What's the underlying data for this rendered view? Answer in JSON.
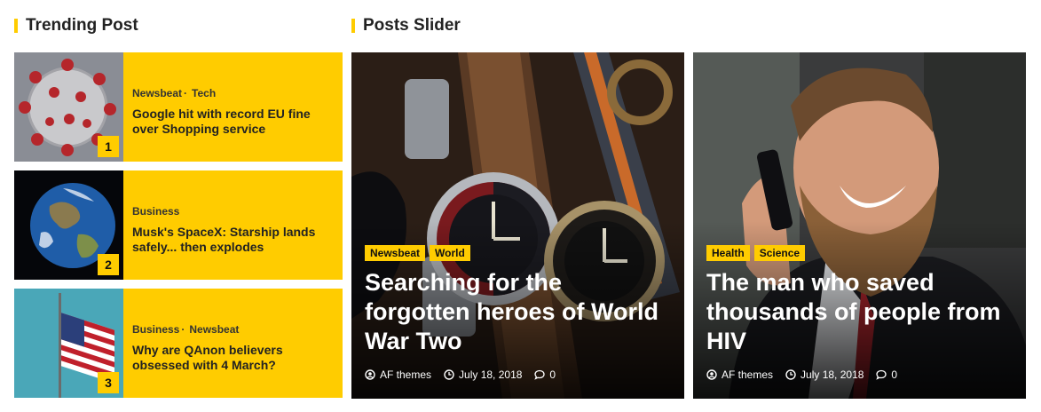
{
  "trending": {
    "title": "Trending Post",
    "items": [
      {
        "rank": "1",
        "categories": [
          "Newsbeat",
          "Tech"
        ],
        "headline": "Google hit with record EU fine over Shopping service",
        "thumb": "virus-image"
      },
      {
        "rank": "2",
        "categories": [
          "Business"
        ],
        "headline": "Musk's SpaceX: Starship lands safely... then explodes",
        "thumb": "earth-image"
      },
      {
        "rank": "3",
        "categories": [
          "Business",
          "Newsbeat"
        ],
        "headline": "Why are QAnon believers obsessed with 4 March?",
        "thumb": "flag-image"
      }
    ]
  },
  "slider": {
    "title": "Posts Slider",
    "slides": [
      {
        "badges": [
          "Newsbeat",
          "World"
        ],
        "title": "Searching for the forgotten heroes of World War Two",
        "author": "AF themes",
        "date": "July 18, 2018",
        "comments": "0",
        "image": "watches-image"
      },
      {
        "badges": [
          "Health",
          "Science"
        ],
        "title": "The man who saved thousands of people from HIV",
        "author": "AF themes",
        "date": "July 18, 2018",
        "comments": "0",
        "image": "bearded-man-image"
      }
    ]
  },
  "colors": {
    "accent": "#ffcc00",
    "text": "#222222"
  },
  "icons": {
    "author": "user-circle-icon",
    "date": "clock-icon",
    "comments": "comment-icon"
  }
}
